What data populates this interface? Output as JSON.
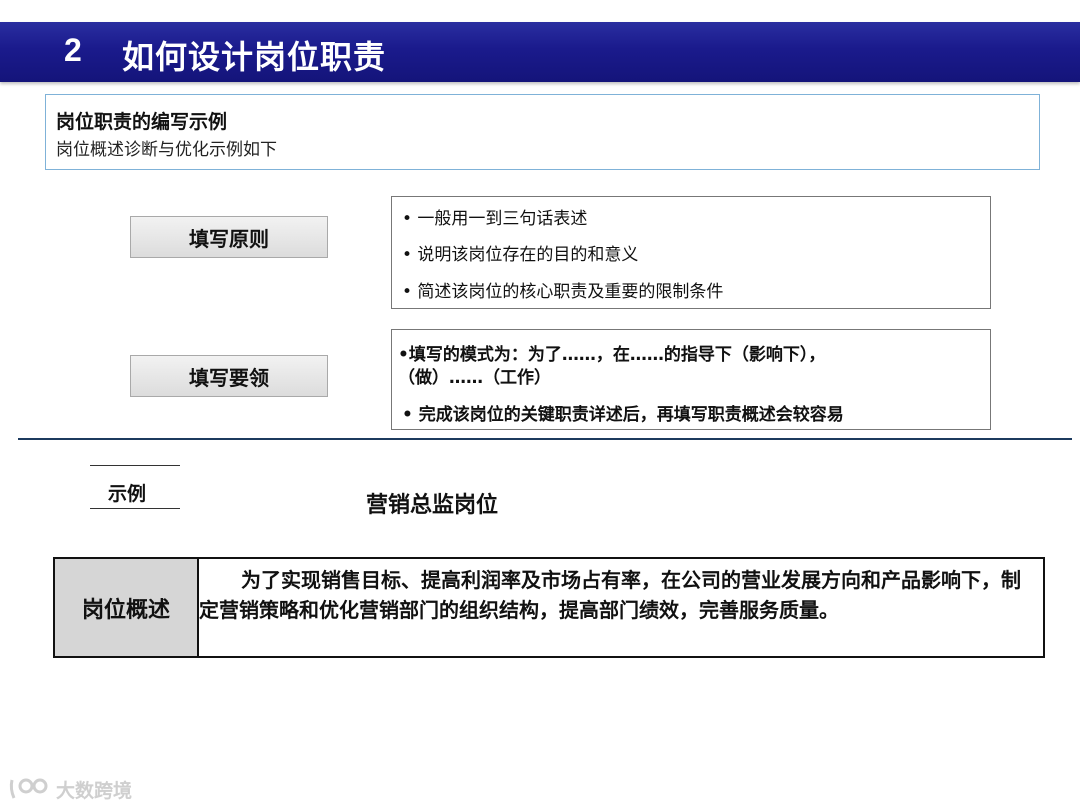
{
  "header": {
    "number": "2",
    "title": "如何设计岗位职责"
  },
  "intro": {
    "heading": "岗位职责的编写示例",
    "subheading": "岗位概述诊断与优化示例如下"
  },
  "principles": {
    "label": "填写原则",
    "items": [
      "• 一般用一到三句话表述",
      "• 说明该岗位存在的目的和意义",
      "• 简述该岗位的核心职责及重要的限制条件"
    ]
  },
  "key_points": {
    "label": "填写要领",
    "items": [
      "•填写的模式为：为了……，在……的指导下（影响下），",
      "（做）……（工作）",
      "• 完成该岗位的关键职责详述后，再填写职责概述会较容易"
    ]
  },
  "example": {
    "label": "示例",
    "position_title": "营销总监岗位",
    "row_header": "岗位概述",
    "row_text": "为了实现销售目标、提高利润率及市场占有率，在公司的营业发展方向和产品影响下，制定营销策略和优化营销部门的组织结构，提高部门绩效，完善服务质量。"
  },
  "watermark": {
    "text": "大数跨境"
  },
  "colors": {
    "title_bar": "#1a1a8c",
    "intro_border": "#7fb2d8",
    "divider": "#1c3a5e",
    "summary_header_bg": "#d6d6d6"
  }
}
